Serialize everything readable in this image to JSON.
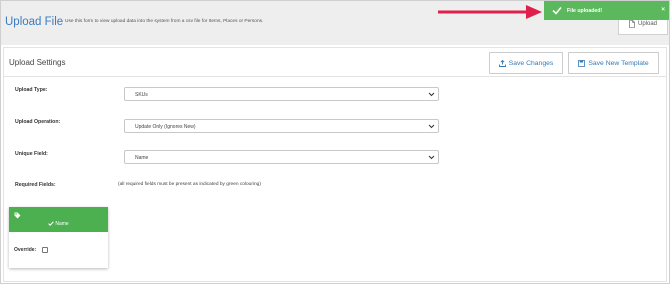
{
  "header": {
    "title": "Upload File",
    "description": "Use this form to view upload data into the system from a csv file for Items, Places or Persons.",
    "upload_label": "Upload"
  },
  "toast": {
    "message": "File uploaded!",
    "close": "×",
    "color": "#5cb85c"
  },
  "annotation": {
    "arrow_color": "#e0204a"
  },
  "settings": {
    "title": "Upload Settings",
    "save_changes_label": "Save Changes",
    "save_template_label": "Save New Template",
    "fields": {
      "upload_type": {
        "label": "Upload Type:",
        "value": "SKUs"
      },
      "upload_operation": {
        "label": "Upload Operation:",
        "value": "Update Only (Ignores New)"
      },
      "unique_field": {
        "label": "Unique Field:",
        "value": "Name"
      },
      "required_fields": {
        "label": "Required Fields:",
        "note": "(all required fields must be present as indicated by green colouring)"
      }
    }
  },
  "field_card": {
    "name": "Name",
    "override_label": "Override:",
    "override_checked": false,
    "color": "#4caf50"
  }
}
